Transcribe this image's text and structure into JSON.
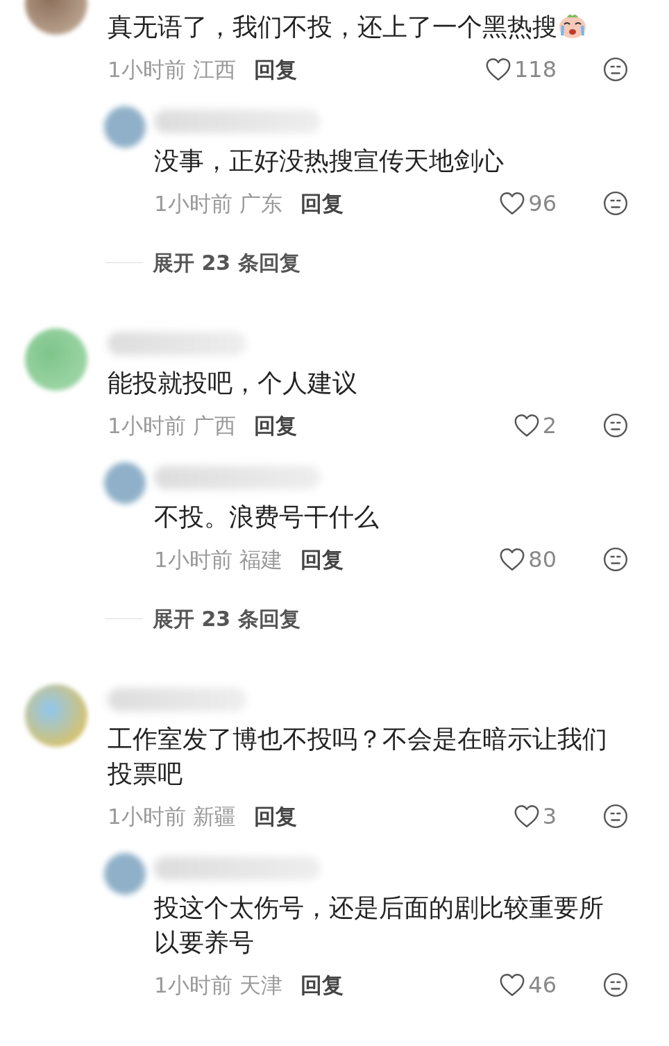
{
  "comments": [
    {
      "text": "真无语了，我们不投，还上了一个黑热搜",
      "emoji": true,
      "time": "1小时前",
      "region": "江西",
      "reply": "回复",
      "likes": "118",
      "replies": [
        {
          "text": "没事，正好没热搜宣传天地剑心",
          "time": "1小时前",
          "region": "广东",
          "reply": "回复",
          "likes": "96"
        }
      ],
      "expand": "展开 23 条回复"
    },
    {
      "text": "能投就投吧，个人建议",
      "emoji": false,
      "time": "1小时前",
      "region": "广西",
      "reply": "回复",
      "likes": "2",
      "replies": [
        {
          "text": "不投。浪费号干什么",
          "time": "1小时前",
          "region": "福建",
          "reply": "回复",
          "likes": "80"
        }
      ],
      "expand": "展开 23 条回复"
    },
    {
      "text": "工作室发了博也不投吗？不会是在暗示让我们投票吧",
      "emoji": false,
      "time": "1小时前",
      "region": "新疆",
      "reply": "回复",
      "likes": "3",
      "replies": [
        {
          "text": "投这个太伤号，还是后面的剧比较重要所以要养号",
          "time": "1小时前",
          "region": "天津",
          "reply": "回复",
          "likes": "46"
        }
      ]
    }
  ]
}
